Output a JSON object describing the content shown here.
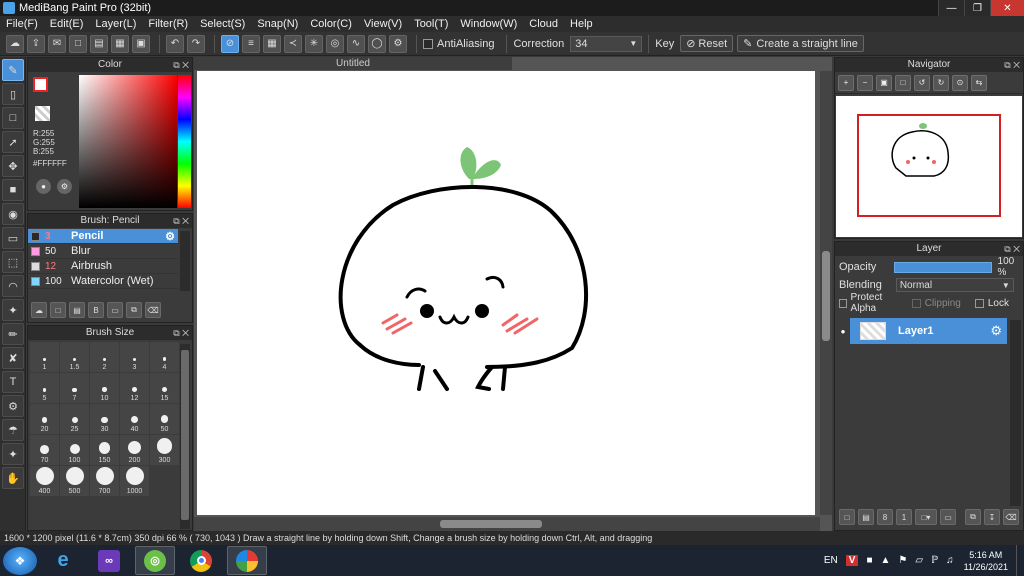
{
  "window": {
    "title": "MediBang Paint Pro (32bit)"
  },
  "menu": [
    "File(F)",
    "Edit(E)",
    "Layer(L)",
    "Filter(R)",
    "Select(S)",
    "Snap(N)",
    "Color(C)",
    "View(V)",
    "Tool(T)",
    "Window(W)",
    "Cloud",
    "Help"
  ],
  "toolbar": {
    "antialiasing_label": "AntiAliasing",
    "correction_label": "Correction",
    "correction_value": "34",
    "key_label": "Key",
    "reset_label": "Reset",
    "straight_line_label": "Create a straight line"
  },
  "color_panel": {
    "title": "Color",
    "r": "R:255",
    "g": "G:255",
    "b": "B:255",
    "hex": "#FFFFFF",
    "fg_color": "#FFFFFF"
  },
  "brush_panel": {
    "title": "Brush: Pencil",
    "items": [
      {
        "size": "3",
        "name": "Pencil",
        "color": "#2a2a2a"
      },
      {
        "size": "50",
        "name": "Blur",
        "color": "#ff9be0"
      },
      {
        "size": "12",
        "name": "Airbrush",
        "color": "#dddddd"
      },
      {
        "size": "100",
        "name": "Watercolor (Wet)",
        "color": "#7fd6ff"
      }
    ]
  },
  "size_panel": {
    "title": "Brush Size",
    "sizes": [
      "1",
      "1.5",
      "2",
      "3",
      "4",
      "5",
      "7",
      "10",
      "12",
      "15",
      "20",
      "25",
      "30",
      "40",
      "50",
      "70",
      "100",
      "150",
      "200",
      "300",
      "400",
      "500",
      "700",
      "1000"
    ]
  },
  "canvas": {
    "tab_title": "Untitled"
  },
  "navigator": {
    "title": "Navigator"
  },
  "layer_panel": {
    "title": "Layer",
    "opacity_label": "Opacity",
    "opacity_value": "100 %",
    "opacity_fraction": 1.0,
    "blending_label": "Blending",
    "blending_value": "Normal",
    "protect_alpha_label": "Protect Alpha",
    "clipping_label": "Clipping",
    "lock_label": "Lock",
    "layers": [
      {
        "name": "Layer1"
      }
    ]
  },
  "status": {
    "text": "1600 * 1200 pixel   (11.6 * 8.7cm)   350 dpi   66 %   ( 730, 1043 )   Draw a straight line by holding down Shift, Change a brush size by holding down Ctrl, Alt, and dragging"
  },
  "taskbar": {
    "lang": "EN",
    "time": "5:16 AM",
    "date": "11/26/2021"
  },
  "colors": {
    "accent": "#4a90d9",
    "sprout": "#7cc576",
    "blush": "#f06565",
    "nav_frame": "#d31f1f"
  }
}
